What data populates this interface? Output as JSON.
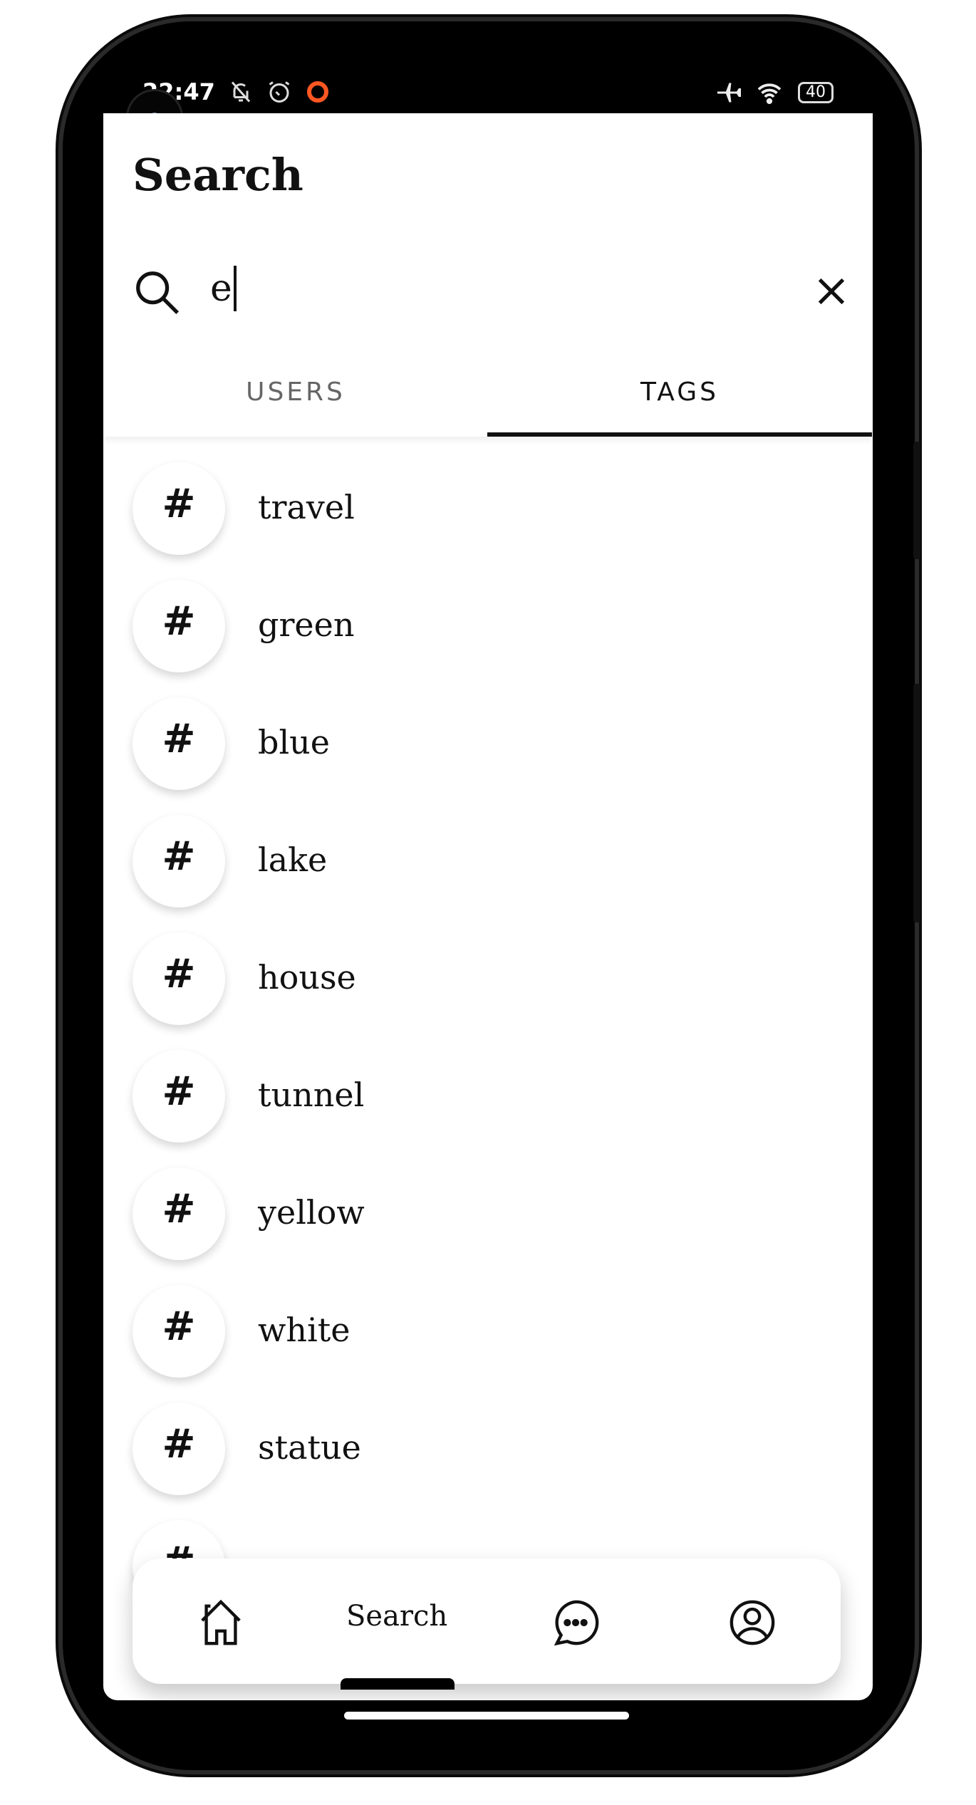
{
  "status_bar": {
    "time": "22:47",
    "battery": "40",
    "icons": [
      "mute-icon",
      "alarm-icon",
      "record-icon",
      "airplane-icon",
      "wifi-icon",
      "battery-icon"
    ],
    "record_color": "#ff5722"
  },
  "header": {
    "title": "Search"
  },
  "search": {
    "value": "e"
  },
  "tabs": [
    {
      "label": "USERS",
      "active": false
    },
    {
      "label": "TAGS",
      "active": true
    }
  ],
  "tags": [
    {
      "label": "travel"
    },
    {
      "label": "green"
    },
    {
      "label": "blue"
    },
    {
      "label": "lake"
    },
    {
      "label": "house"
    },
    {
      "label": "tunnel"
    },
    {
      "label": "yellow"
    },
    {
      "label": "white"
    },
    {
      "label": "statue"
    },
    {
      "label": ""
    }
  ],
  "tag_icon": "#",
  "bottom_nav": {
    "items": [
      {
        "icon": "home-icon"
      },
      {
        "label": "Search",
        "active": true
      },
      {
        "icon": "chat-icon"
      },
      {
        "icon": "profile-icon"
      }
    ]
  }
}
